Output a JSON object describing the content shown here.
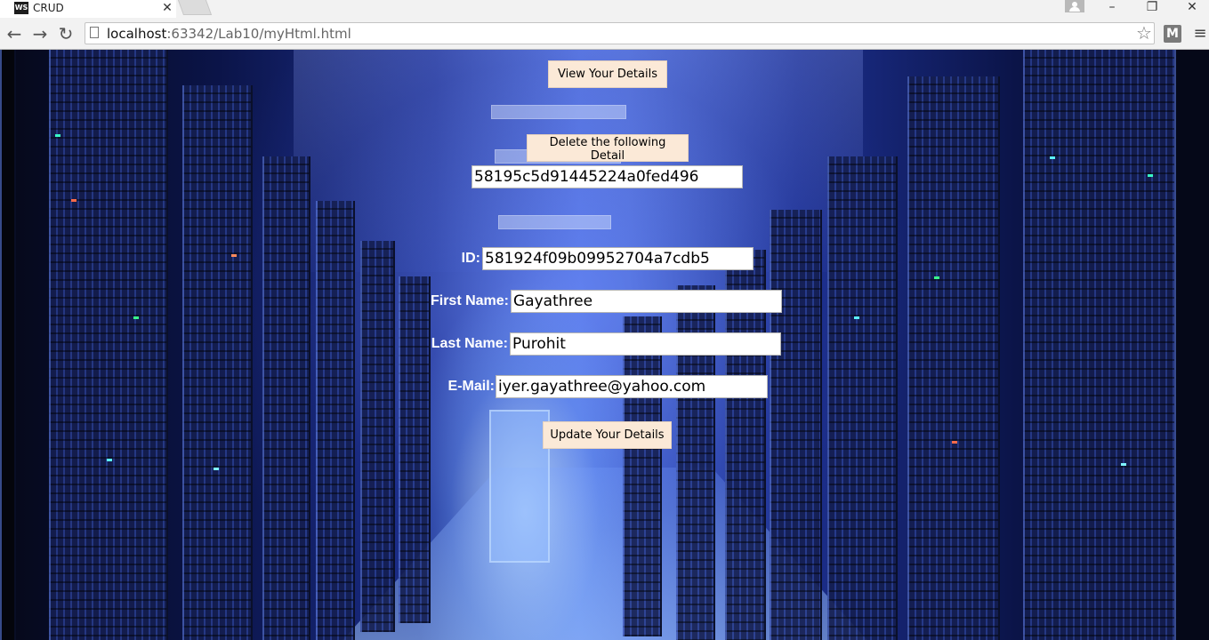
{
  "browser": {
    "tab_title": "CRUD",
    "tab_favicon_text": "WS",
    "url_host": "localhost",
    "url_rest": ":63342/Lab10/myHtml.html",
    "extension_label": "M"
  },
  "page": {
    "view_button_label": "View Your Details",
    "delete_button_label": "Delete the following Detail",
    "delete_id_value": "58195c5d91445224a0fed496",
    "update_form": {
      "id_label": "ID:",
      "id_value": "581924f09b09952704a7cdb5",
      "first_name_label": "First Name:",
      "first_name_value": "Gayathree",
      "last_name_label": "Last Name:",
      "last_name_value": "Purohit",
      "email_label": "E-Mail:",
      "email_value": "iyer.gayathree@yahoo.com"
    },
    "update_button_label": "Update Your Details"
  }
}
